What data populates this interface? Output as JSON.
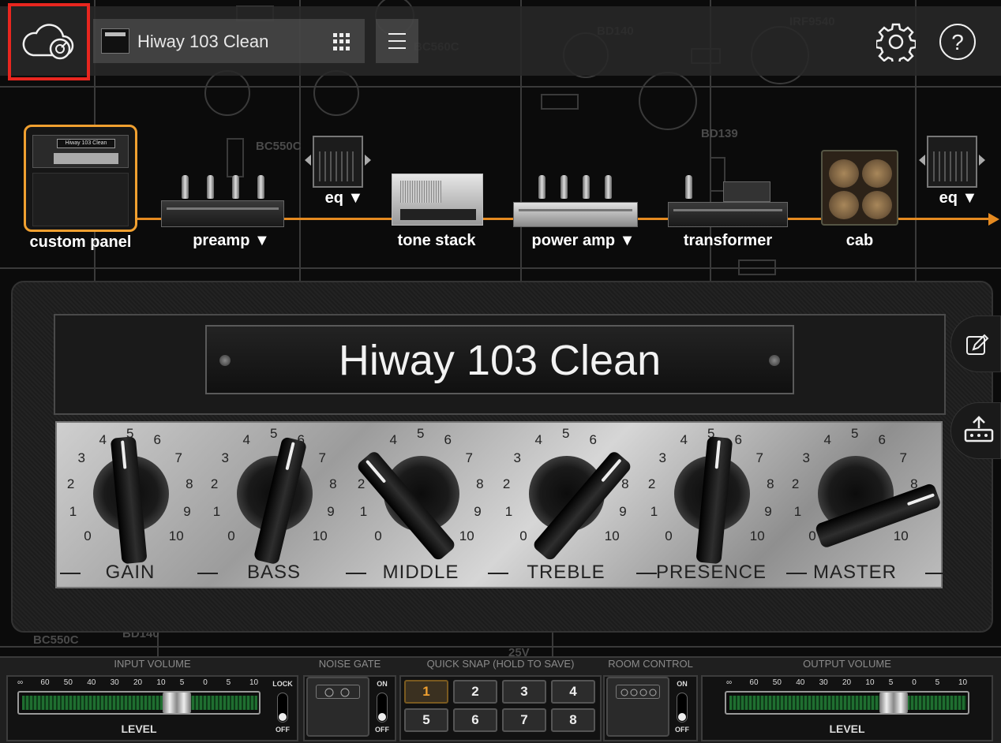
{
  "header": {
    "cloud_icon": "cloud-with-dial-icon",
    "preset_name": "Hiway 103 Clean",
    "grid_icon": "grid-icon",
    "menu_icon": "hamburger-menu-icon",
    "settings_icon": "gear-icon",
    "help_label": "?"
  },
  "chain": {
    "custom_panel": "custom panel",
    "amp_badge": "Hiway 103 Clean",
    "preamp": "preamp ▼",
    "eq1": "eq ▼",
    "tone_stack": "tone stack",
    "power_amp": "power amp ▼",
    "transformer": "transformer",
    "cab": "cab",
    "eq2": "eq ▼",
    "accent": "#e58a20"
  },
  "amp": {
    "title": "Hiway 103 Clean",
    "knobs": [
      {
        "label": "GAIN",
        "value": 4.8
      },
      {
        "label": "BASS",
        "value": 5.5
      },
      {
        "label": "MIDDLE",
        "value": 3.5
      },
      {
        "label": "TREBLE",
        "value": 6.5
      },
      {
        "label": "PRESENCE",
        "value": 5.2
      },
      {
        "label": "MASTER",
        "value": 7.6
      }
    ],
    "scale": [
      "0",
      "1",
      "2",
      "3",
      "4",
      "5",
      "6",
      "7",
      "8",
      "9",
      "10"
    ]
  },
  "side": {
    "edit_icon": "edit-pencil-icon",
    "export_icon": "upload-tray-icon"
  },
  "bottom": {
    "input_volume": {
      "title": "INPUT VOLUME",
      "scale": [
        "∞",
        "60",
        "50",
        "40",
        "30",
        "20",
        "10",
        "5",
        "0",
        "5",
        "10"
      ],
      "level_label": "LEVEL",
      "level_fraction": 0.69,
      "lock_on": "LOCK",
      "lock_off": "OFF"
    },
    "noise_gate": {
      "title": "NOISE GATE",
      "on": "ON",
      "off": "OFF"
    },
    "quick_snap": {
      "title": "QUICK SNAP (HOLD TO SAVE)",
      "buttons": [
        "1",
        "2",
        "3",
        "4",
        "5",
        "6",
        "7",
        "8"
      ],
      "active": "1"
    },
    "room_control": {
      "title": "ROOM CONTROL",
      "on": "ON",
      "off": "OFF"
    },
    "output_volume": {
      "title": "OUTPUT VOLUME",
      "scale": [
        "∞",
        "60",
        "50",
        "40",
        "30",
        "20",
        "10",
        "5",
        "0",
        "5",
        "10"
      ],
      "level_label": "LEVEL",
      "level_fraction": 0.73
    }
  }
}
